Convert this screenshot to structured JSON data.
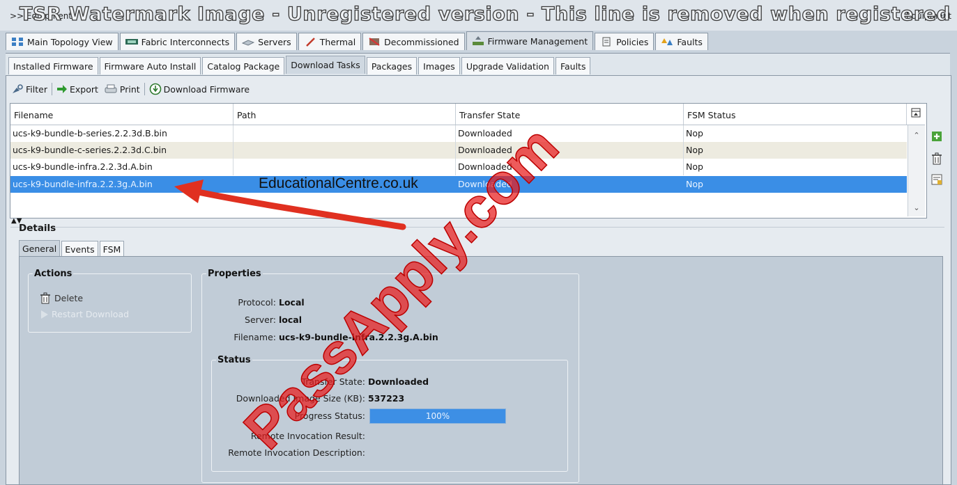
{
  "window": {
    "breadcrumb": ">> Equipment",
    "right_label": "Equipment",
    "watermark": "TSR Watermark Image - Unregistered version - This line is removed when registered"
  },
  "main_tabs": [
    {
      "label": "Main Topology View",
      "icon": "topology-icon"
    },
    {
      "label": "Fabric Interconnects",
      "icon": "fabric-icon"
    },
    {
      "label": "Servers",
      "icon": "server-icon"
    },
    {
      "label": "Thermal",
      "icon": "thermal-icon"
    },
    {
      "label": "Decommissioned",
      "icon": "decommission-icon"
    },
    {
      "label": "Firmware Management",
      "icon": "firmware-icon",
      "active": true
    },
    {
      "label": "Policies",
      "icon": "policy-icon"
    },
    {
      "label": "Faults",
      "icon": "fault-icon"
    }
  ],
  "sub_tabs": [
    {
      "label": "Installed Firmware"
    },
    {
      "label": "Firmware Auto Install"
    },
    {
      "label": "Catalog Package"
    },
    {
      "label": "Download Tasks",
      "active": true
    },
    {
      "label": "Packages"
    },
    {
      "label": "Images"
    },
    {
      "label": "Upgrade Validation"
    },
    {
      "label": "Faults"
    }
  ],
  "toolbar": {
    "filter": "Filter",
    "export": "Export",
    "print": "Print",
    "download_firmware": "Download Firmware"
  },
  "table": {
    "columns": [
      "Filename",
      "Path",
      "Transfer State",
      "FSM Status"
    ],
    "rows": [
      {
        "filename": "ucs-k9-bundle-b-series.2.2.3d.B.bin",
        "path": "",
        "transfer_state": "Downloaded",
        "fsm_status": "Nop"
      },
      {
        "filename": "ucs-k9-bundle-c-series.2.2.3d.C.bin",
        "path": "",
        "transfer_state": "Downloaded",
        "fsm_status": "Nop"
      },
      {
        "filename": "ucs-k9-bundle-infra.2.2.3d.A.bin",
        "path": "",
        "transfer_state": "Downloaded",
        "fsm_status": "Nop"
      },
      {
        "filename": "ucs-k9-bundle-infra.2.2.3g.A.bin",
        "path": "",
        "transfer_state": "Downloaded",
        "fsm_status": "Nop",
        "selected": true
      }
    ]
  },
  "details": {
    "title": "Details",
    "tabs": [
      {
        "label": "General",
        "active": true
      },
      {
        "label": "Events"
      },
      {
        "label": "FSM"
      }
    ],
    "actions": {
      "title": "Actions",
      "delete": "Delete",
      "restart_download": "Restart Download"
    },
    "properties": {
      "title": "Properties",
      "protocol_label": "Protocol:",
      "protocol": "Local",
      "server_label": "Server:",
      "server": "local",
      "filename_label": "Filename:",
      "filename": "ucs-k9-bundle-infra.2.2.3g.A.bin"
    },
    "status": {
      "title": "Status",
      "transfer_state_label": "Transfer State:",
      "transfer_state": "Downloaded",
      "image_size_label": "Downloaded Image Size (KB):",
      "image_size": "537223",
      "progress_label": "Progress Status:",
      "progress": "100%",
      "remote_result_label": "Remote Invocation Result:",
      "remote_result": "",
      "remote_desc_label": "Remote Invocation Description:",
      "remote_desc": ""
    }
  },
  "overlays": {
    "annotation_text": "EducationalCentre.co.uk",
    "stamp_text": "PassApply.com",
    "arrow_color": "#e03020"
  },
  "colors": {
    "selection": "#3a8ee6",
    "progress": "#3d8fe5",
    "panel": "#c1ccd7"
  }
}
